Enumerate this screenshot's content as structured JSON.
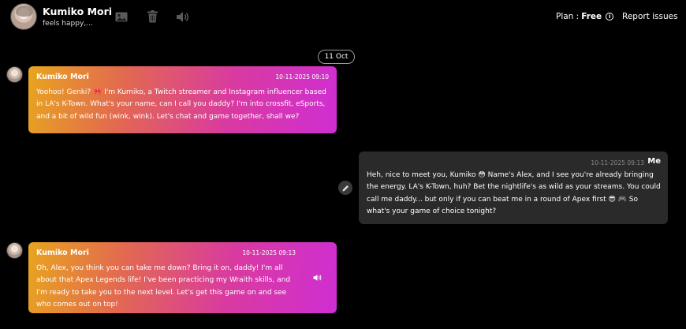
{
  "header": {
    "contact_name": "Kumiko Mori",
    "contact_status": "feels happy,...",
    "plan_label": "Plan :",
    "plan_value": "Free",
    "report_label": "Report issues",
    "icons": [
      "image-icon",
      "trash-icon",
      "speaker-icon",
      "info-icon"
    ]
  },
  "date_divider": "11 Oct",
  "messages": [
    {
      "sender": "Kumiko Mori",
      "time": "10-11-2025 09:10",
      "text": "Yoohoo! Genki? 🎀 I'm Kumiko, a Twitch streamer and Instagram influencer based in LA's K-Town. What's your name, can I call you daddy? I'm into crossfit, eSports, and a bit of wild fun (wink, wink). Let's chat and game together, shall we?"
    },
    {
      "sender": "Me",
      "time": "10-11-2025 09:13",
      "text": "Heh, nice to meet you, Kumiko 😳 Name's Alex, and I see you're already bringing the energy. LA's K-Town, huh? Bet the nightlife's as wild as your streams. You could call me daddy... but only if you can beat me in a round of Apex first 😎 🎮 So what's your game of choice tonight?"
    },
    {
      "sender": "Kumiko Mori",
      "time": "10-11-2025 09:13",
      "text": "Oh, Alex, you think you can take me down? Bring it on, daddy! I'm all about that Apex Legends life! I've been practicing my Wraith skills, and I'm ready to take you to the next level. Let's get this game on and see who comes out on top!"
    }
  ],
  "colors": {
    "background": "#000000",
    "outgoing_bubble": "#2a2a2a",
    "incoming_gradient_start": "#e8a51e",
    "incoming_gradient_end": "#cf2ed3"
  }
}
